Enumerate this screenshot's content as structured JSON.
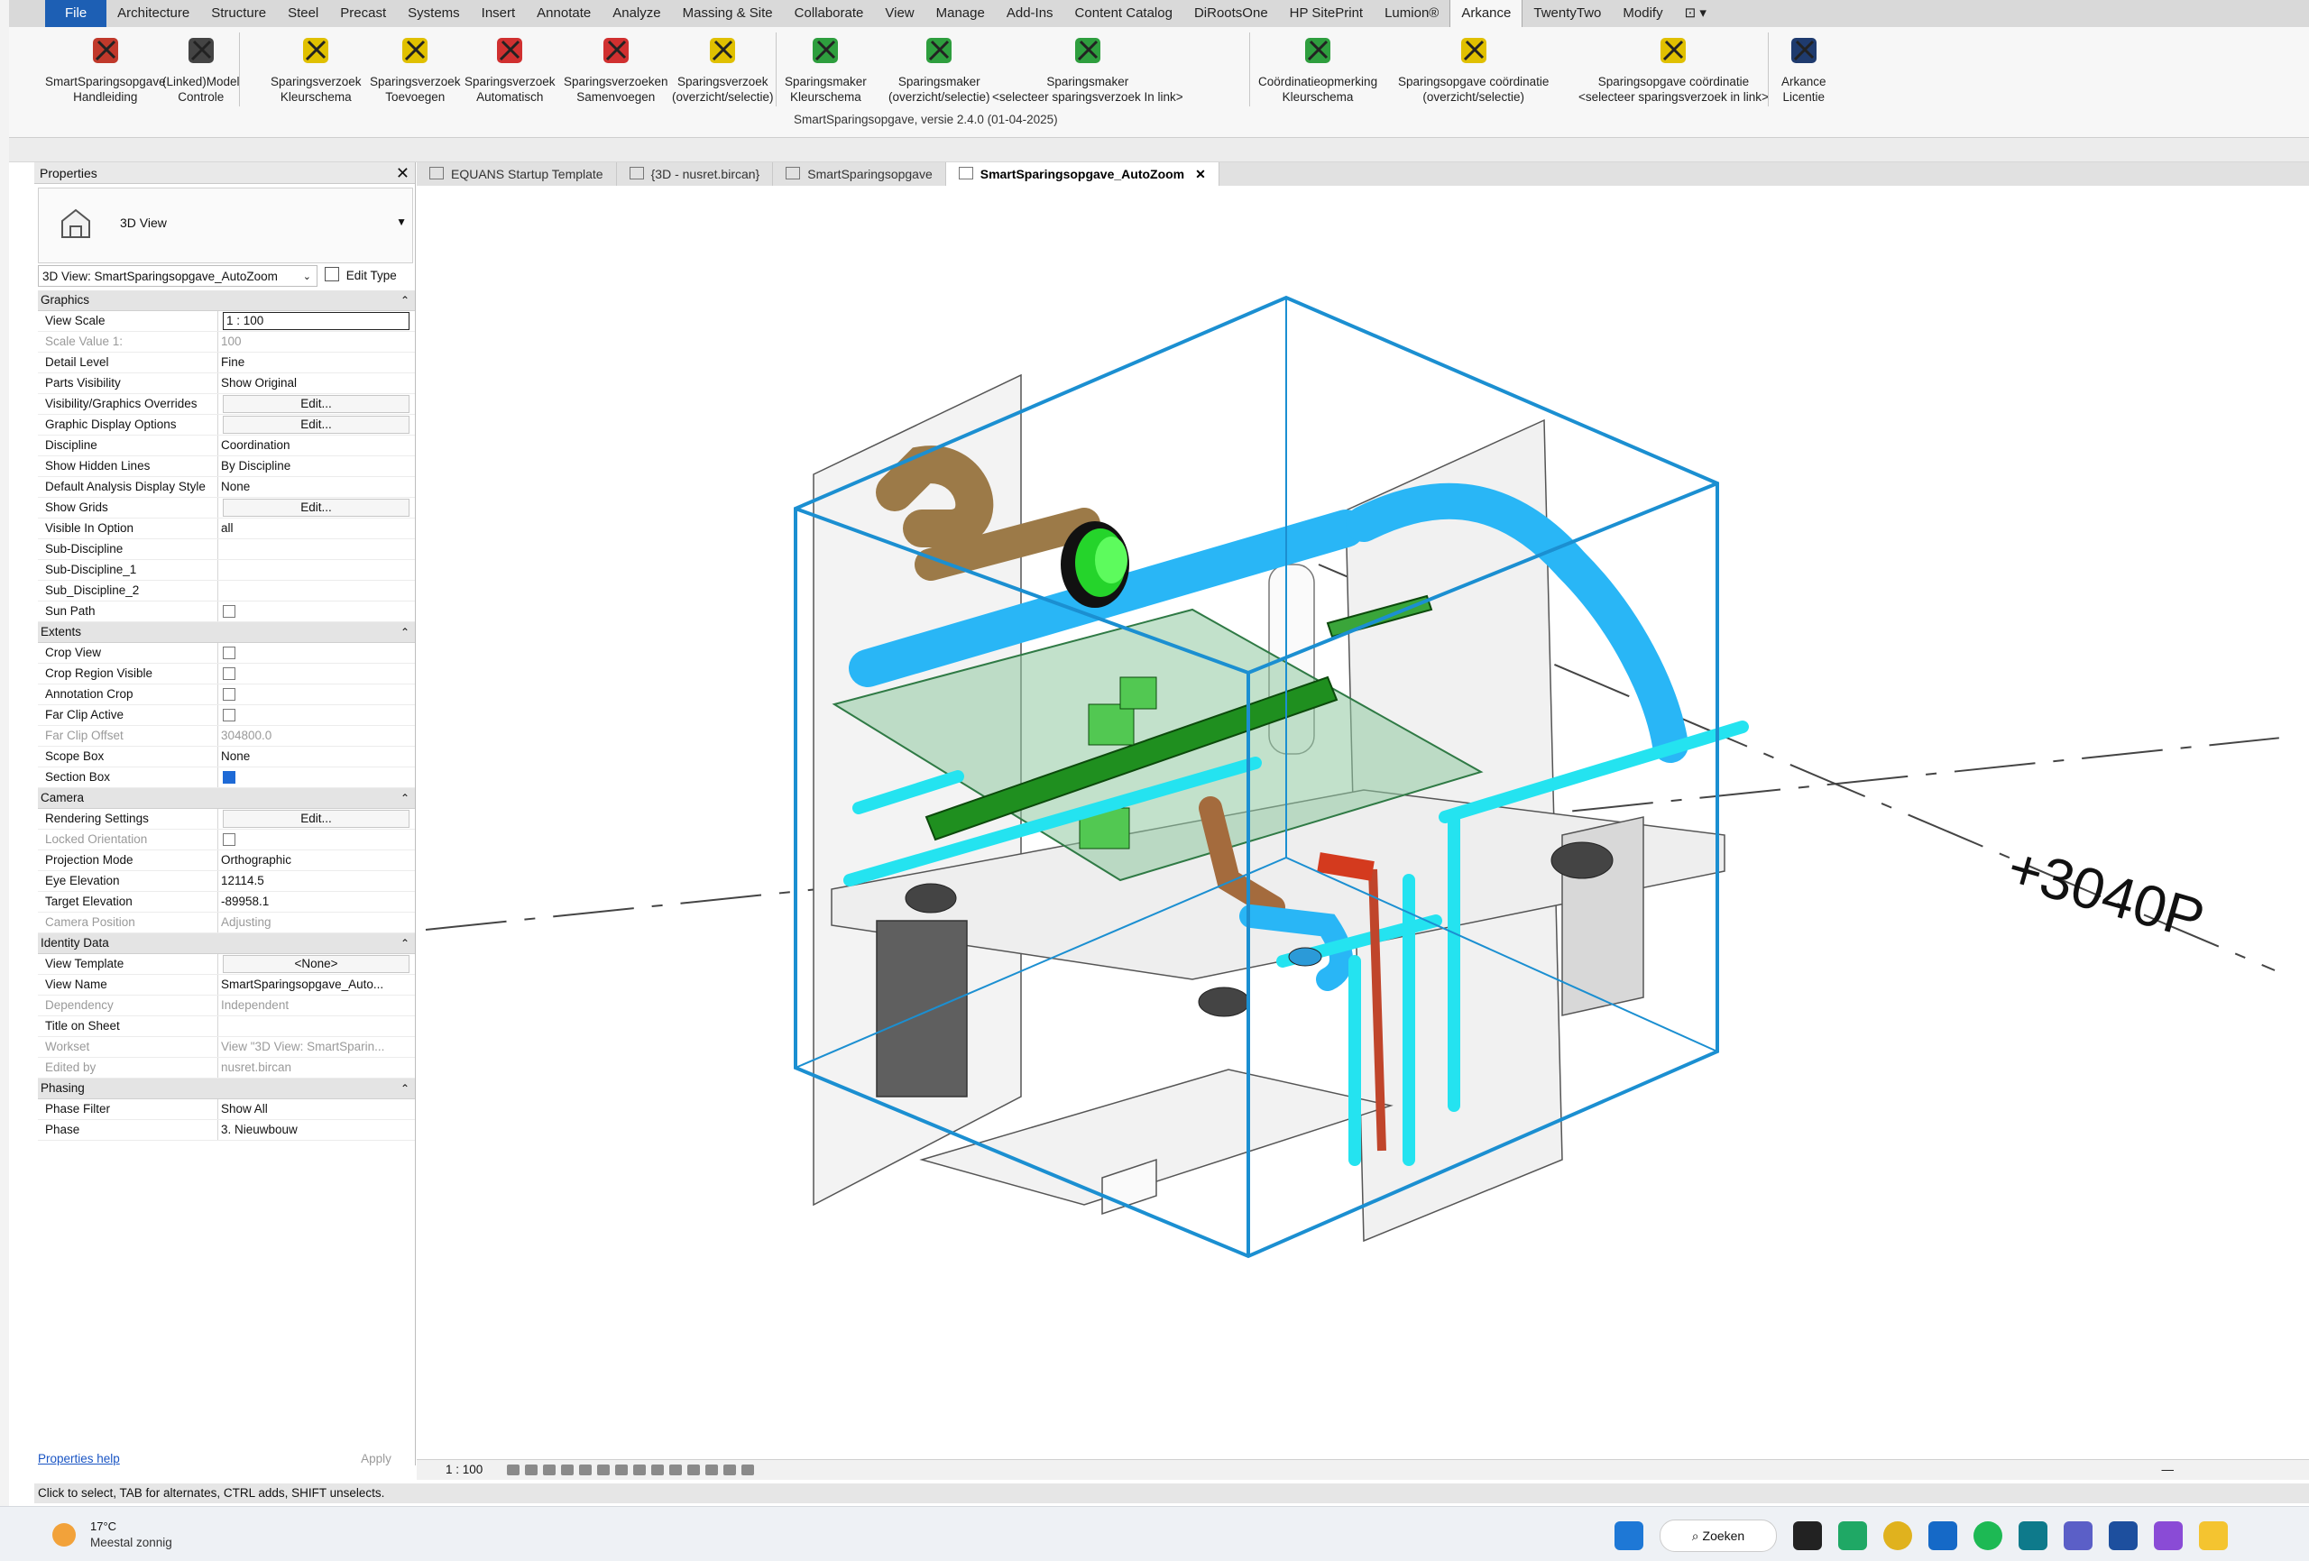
{
  "ribbon_tabs": [
    "File",
    "Architecture",
    "Structure",
    "Steel",
    "Precast",
    "Systems",
    "Insert",
    "Annotate",
    "Analyze",
    "Massing & Site",
    "Collaborate",
    "View",
    "Manage",
    "Add-Ins",
    "Content Catalog",
    "DiRootsOne",
    "HP SitePrint",
    "Lumion®",
    "Arkance",
    "TwentyTwo",
    "Modify",
    "⊡ ▾"
  ],
  "active_tab": "Arkance",
  "ribbon_buttons": [
    {
      "l1": "SmartSparingsopgave",
      "l2": "Handleiding",
      "icon": "pdf-icon",
      "color": "#c0392b"
    },
    {
      "l1": "(Linked)Model",
      "l2": "Controle",
      "icon": "magnifier-icon",
      "color": "#444444"
    },
    {
      "l1": "Sparingsverzoek",
      "l2": "Kleurschema",
      "icon": "color-cube-icon",
      "color": "#e0c000"
    },
    {
      "l1": "Sparingsverzoek",
      "l2": "Toevoegen",
      "icon": "tools-add-icon",
      "color": "#e0c000"
    },
    {
      "l1": "Sparingsverzoek",
      "l2": "Automatisch",
      "icon": "tools-auto-icon",
      "color": "#d03030"
    },
    {
      "l1": "Sparingsverzoeken",
      "l2": "Samenvoegen",
      "icon": "merge-icon",
      "color": "#d03030"
    },
    {
      "l1": "Sparingsverzoek",
      "l2": "(overzicht/selectie)",
      "icon": "tools-overview-icon",
      "color": "#e0c000"
    },
    {
      "l1": "Sparingsmaker",
      "l2": "Kleurschema",
      "icon": "green-cube-icon",
      "color": "#2e9e3e"
    },
    {
      "l1": "Sparingsmaker",
      "l2": "(overzicht/selectie)",
      "icon": "tools-green-icon",
      "color": "#2e9e3e"
    },
    {
      "l1": "Sparingsmaker",
      "l2": "<selecteer sparingsverzoek In link>",
      "icon": "tools-link-icon",
      "color": "#2e9e3e"
    },
    {
      "l1": "Coördinatieopmerking",
      "l2": "Kleurschema",
      "icon": "coord-cube-icon",
      "color": "#2e9e3e"
    },
    {
      "l1": "Sparingsopgave coördinatie",
      "l2": "(overzicht/selectie)",
      "icon": "tools-coord-icon",
      "color": "#e0c000"
    },
    {
      "l1": "Sparingsopgave coördinatie",
      "l2": "<selecteer sparingsverzoek in link>",
      "icon": "tools-coord-link-icon",
      "color": "#e0c000"
    },
    {
      "l1": "Arkance",
      "l2": "Licentie",
      "icon": "arkance-logo-icon",
      "color": "#1f3b6e"
    }
  ],
  "ribbon_caption": "SmartSparingsopgave, versie 2.4.0 (01-04-2025)",
  "properties": {
    "title": "Properties",
    "type_name": "3D View",
    "instance_selector": "3D View: SmartSparingsopgave_AutoZoom",
    "edit_type": "Edit Type",
    "help": "Properties help",
    "apply": "Apply",
    "groups": [
      {
        "name": "Graphics",
        "rows": [
          {
            "k": "View Scale",
            "v": "1 : 100",
            "kind": "input"
          },
          {
            "k": "Scale Value    1:",
            "v": "100",
            "dis": true
          },
          {
            "k": "Detail Level",
            "v": "Fine"
          },
          {
            "k": "Parts Visibility",
            "v": "Show Original"
          },
          {
            "k": "Visibility/Graphics Overrides",
            "v": "Edit...",
            "kind": "button"
          },
          {
            "k": "Graphic Display Options",
            "v": "Edit...",
            "kind": "button"
          },
          {
            "k": "Discipline",
            "v": "Coordination"
          },
          {
            "k": "Show Hidden Lines",
            "v": "By Discipline"
          },
          {
            "k": "Default Analysis Display Style",
            "v": "None"
          },
          {
            "k": "Show Grids",
            "v": "Edit...",
            "kind": "button"
          },
          {
            "k": "Visible In Option",
            "v": "all"
          },
          {
            "k": "Sub-Discipline",
            "v": ""
          },
          {
            "k": "Sub-Discipline_1",
            "v": ""
          },
          {
            "k": "Sub_Discipline_2",
            "v": ""
          },
          {
            "k": "Sun Path",
            "v": "",
            "kind": "check",
            "on": false
          }
        ]
      },
      {
        "name": "Extents",
        "rows": [
          {
            "k": "Crop View",
            "v": "",
            "kind": "check",
            "on": false
          },
          {
            "k": "Crop Region Visible",
            "v": "",
            "kind": "check",
            "on": false
          },
          {
            "k": "Annotation Crop",
            "v": "",
            "kind": "check",
            "on": false
          },
          {
            "k": "Far Clip Active",
            "v": "",
            "kind": "check",
            "on": false
          },
          {
            "k": "Far Clip Offset",
            "v": "304800.0",
            "dis": true
          },
          {
            "k": "Scope Box",
            "v": "None"
          },
          {
            "k": "Section Box",
            "v": "",
            "kind": "check",
            "on": true
          }
        ]
      },
      {
        "name": "Camera",
        "rows": [
          {
            "k": "Rendering Settings",
            "v": "Edit...",
            "kind": "button"
          },
          {
            "k": "Locked Orientation",
            "v": "",
            "kind": "check",
            "on": false,
            "dis": true
          },
          {
            "k": "Projection Mode",
            "v": "Orthographic"
          },
          {
            "k": "Eye Elevation",
            "v": "12114.5"
          },
          {
            "k": "Target Elevation",
            "v": "-89958.1"
          },
          {
            "k": "Camera Position",
            "v": "Adjusting",
            "dis": true
          }
        ]
      },
      {
        "name": "Identity Data",
        "rows": [
          {
            "k": "View Template",
            "v": "<None>",
            "kind": "button"
          },
          {
            "k": "View Name",
            "v": "SmartSparingsopgave_Auto..."
          },
          {
            "k": "Dependency",
            "v": "Independent",
            "dis": true
          },
          {
            "k": "Title on Sheet",
            "v": ""
          },
          {
            "k": "Workset",
            "v": "View \"3D View: SmartSparin...",
            "dis": true
          },
          {
            "k": "Edited by",
            "v": "nusret.bircan",
            "dis": true
          }
        ]
      },
      {
        "name": "Phasing",
        "rows": [
          {
            "k": "Phase Filter",
            "v": "Show All"
          },
          {
            "k": "Phase",
            "v": "3. Nieuwbouw"
          }
        ]
      }
    ]
  },
  "view_tabs": [
    {
      "label": "EQUANS Startup Template",
      "active": false
    },
    {
      "label": "{3D - nusret.bircan}",
      "active": false
    },
    {
      "label": "SmartSparingsopgave",
      "active": false
    },
    {
      "label": "SmartSparingsopgave_AutoZoom",
      "active": true
    }
  ],
  "canvas": {
    "level_tag": "+3040P"
  },
  "view_control": {
    "scale": "1 : 100",
    "minimize": "—"
  },
  "status_text": "Click to select, TAB for alternates, CTRL adds, SHIFT unselects.",
  "taskbar": {
    "temp": "17°C",
    "weather": "Meestal zonnig",
    "search": "Zoeken"
  },
  "colors": {
    "accent": "#1d5fb4",
    "section_box": "#1b8fd1",
    "duct_blue": "#29b6f6",
    "pipe_cyan": "#24e3f0",
    "duct_brown": "#9c7a48",
    "cable_tray": "#1f8f1f"
  }
}
